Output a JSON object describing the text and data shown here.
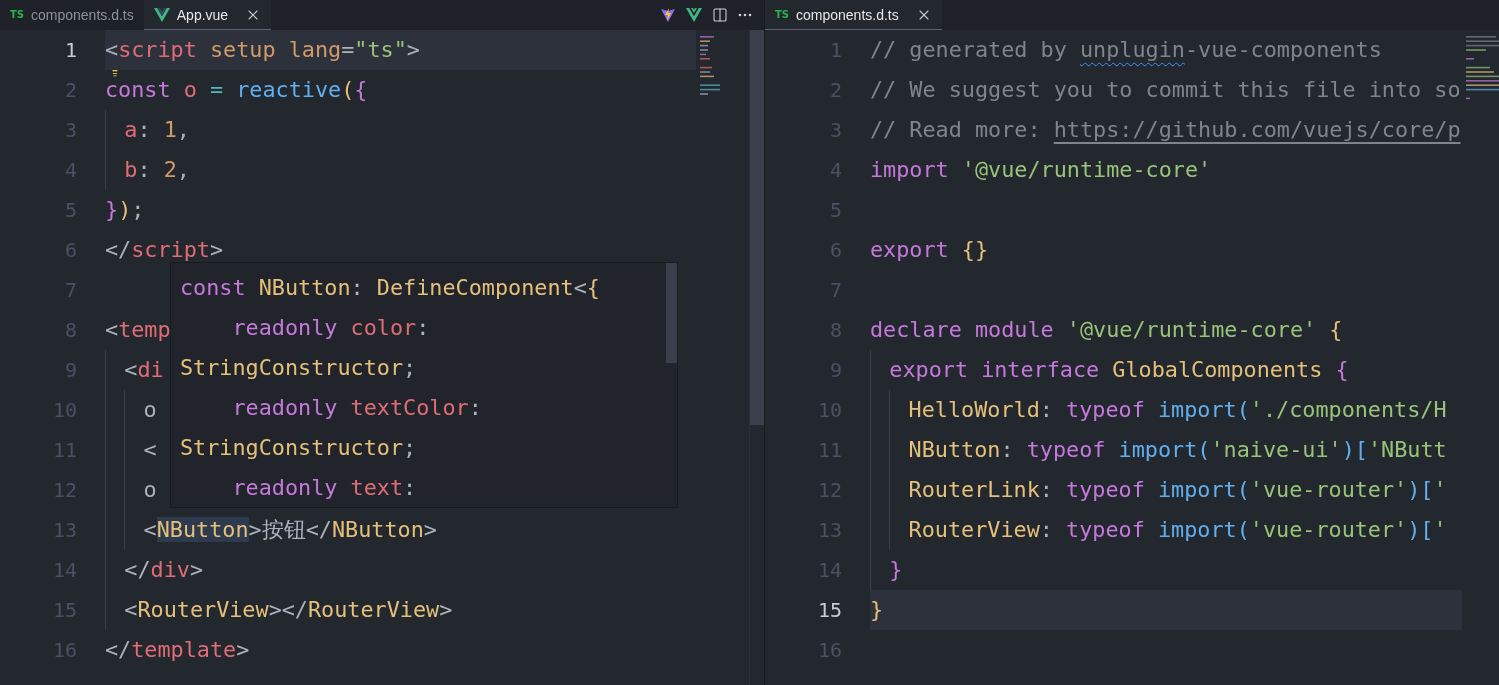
{
  "left_group": {
    "tabs": [
      {
        "label": "components.d.ts",
        "kind": "ts",
        "badge": "TS",
        "selected": false
      },
      {
        "label": "App.vue",
        "kind": "vue",
        "selected": true
      }
    ],
    "editor": {
      "lines": [
        {
          "number": "1",
          "current": true,
          "lightbulb": false,
          "tokens": [
            {
              "kind": "punct",
              "t": "<"
            },
            {
              "kind": "tag",
              "t": "script"
            },
            {
              "kind": "attr",
              "t": " setup lang"
            },
            {
              "kind": "punct",
              "t": "="
            },
            {
              "kind": "string",
              "t": "\"ts\""
            },
            {
              "kind": "punct",
              "t": ">"
            }
          ]
        },
        {
          "number": "2",
          "current": false,
          "lightbulb": true,
          "tokens": [
            {
              "kind": "keyword",
              "t": "const"
            },
            {
              "kind": "var",
              "t": " o"
            },
            {
              "kind": "op",
              "t": " = "
            },
            {
              "kind": "func",
              "t": "reactive"
            },
            {
              "kind": "bracket",
              "t": "("
            },
            {
              "kind": "bracket2",
              "t": "{"
            }
          ]
        },
        {
          "number": "3",
          "current": false,
          "lightbulb": false,
          "tokens": [
            {
              "kind": "var",
              "t": "  a"
            },
            {
              "kind": "punct",
              "t": ": "
            },
            {
              "kind": "number",
              "t": "1"
            },
            {
              "kind": "punct",
              "t": ","
            }
          ]
        },
        {
          "number": "4",
          "current": false,
          "lightbulb": false,
          "tokens": [
            {
              "kind": "var",
              "t": "  b"
            },
            {
              "kind": "punct",
              "t": ": "
            },
            {
              "kind": "number",
              "t": "2"
            },
            {
              "kind": "punct",
              "t": ","
            }
          ]
        },
        {
          "number": "5",
          "current": false,
          "lightbulb": false,
          "tokens": [
            {
              "kind": "bracket2",
              "t": "}"
            },
            {
              "kind": "bracket",
              "t": ")"
            },
            {
              "kind": "punct",
              "t": ";"
            }
          ]
        },
        {
          "number": "6",
          "current": false,
          "lightbulb": false,
          "tokens": [
            {
              "kind": "punct",
              "t": "</"
            },
            {
              "kind": "tag",
              "t": "script"
            },
            {
              "kind": "punct",
              "t": ">"
            }
          ]
        },
        {
          "number": "7",
          "current": false,
          "lightbulb": false
        },
        {
          "number": "8",
          "current": false,
          "lightbulb": false,
          "tokens": [
            {
              "kind": "punct",
              "t": "<"
            },
            {
              "kind": "tag",
              "t": "temp"
            }
          ]
        },
        {
          "number": "9",
          "current": false,
          "lightbulb": false,
          "tokens": [
            {
              "kind": "punct",
              "t": "  <"
            },
            {
              "kind": "tag",
              "t": "di"
            }
          ]
        },
        {
          "number": "10",
          "current": false,
          "lightbulb": false,
          "tokens": [
            {
              "kind": "plain",
              "t": "    o"
            }
          ]
        },
        {
          "number": "11",
          "current": false,
          "lightbulb": false,
          "tokens": [
            {
              "kind": "punct",
              "t": "    <"
            }
          ]
        },
        {
          "number": "12",
          "current": false,
          "lightbulb": false,
          "tokens": [
            {
              "kind": "plain",
              "t": "    o"
            }
          ]
        },
        {
          "number": "13",
          "current": false,
          "lightbulb": false,
          "tokens": [
            {
              "kind": "punct",
              "t": "    <"
            },
            {
              "kind": "type",
              "t": "NButton",
              "highlight": true
            },
            {
              "kind": "punct",
              "t": ">"
            },
            {
              "kind": "plain",
              "t": "按钮"
            },
            {
              "kind": "punct",
              "t": "</"
            },
            {
              "kind": "type",
              "t": "NButton"
            },
            {
              "kind": "punct",
              "t": ">"
            }
          ]
        },
        {
          "number": "14",
          "current": false,
          "lightbulb": false,
          "tokens": [
            {
              "kind": "punct",
              "t": "  </"
            },
            {
              "kind": "tag",
              "t": "div"
            },
            {
              "kind": "punct",
              "t": ">"
            }
          ]
        },
        {
          "number": "15",
          "current": false,
          "lightbulb": false,
          "tokens": [
            {
              "kind": "punct",
              "t": "  <"
            },
            {
              "kind": "type",
              "t": "RouterView"
            },
            {
              "kind": "punct",
              "t": "></"
            },
            {
              "kind": "type",
              "t": "RouterView"
            },
            {
              "kind": "punct",
              "t": ">"
            }
          ]
        },
        {
          "number": "16",
          "current": false,
          "lightbulb": false,
          "tokens": [
            {
              "kind": "punct",
              "t": "</"
            },
            {
              "kind": "tag",
              "t": "template"
            },
            {
              "kind": "punct",
              "t": ">"
            }
          ]
        }
      ],
      "hover": {
        "lines": [
          {
            "tokens": [
              {
                "kind": "keyword",
                "t": "const"
              },
              {
                "kind": "type",
                "t": " NButton"
              },
              {
                "kind": "punct",
                "t": ": "
              },
              {
                "kind": "type",
                "t": "DefineComponent"
              },
              {
                "kind": "punct",
                "t": "<"
              },
              {
                "kind": "bracket",
                "t": "{"
              }
            ]
          },
          {
            "tokens": [
              {
                "kind": "keyword",
                "t": "    readonly"
              },
              {
                "kind": "var",
                "t": " color"
              },
              {
                "kind": "punct",
                "t": ":"
              }
            ]
          },
          {
            "tokens": [
              {
                "kind": "type",
                "t": "StringConstructor"
              },
              {
                "kind": "punct",
                "t": ";"
              }
            ]
          },
          {
            "tokens": [
              {
                "kind": "keyword",
                "t": "    readonly"
              },
              {
                "kind": "var",
                "t": " textColor"
              },
              {
                "kind": "punct",
                "t": ":"
              }
            ]
          },
          {
            "tokens": [
              {
                "kind": "type",
                "t": "StringConstructor"
              },
              {
                "kind": "punct",
                "t": ";"
              }
            ]
          },
          {
            "tokens": [
              {
                "kind": "keyword",
                "t": "    readonly"
              },
              {
                "kind": "var",
                "t": " text"
              },
              {
                "kind": "punct",
                "t": ":"
              }
            ]
          }
        ]
      }
    }
  },
  "right_group": {
    "tabs": [
      {
        "label": "components.d.ts",
        "kind": "ts",
        "badge": "TS",
        "selected": true
      }
    ],
    "editor": {
      "lines": [
        {
          "number": "1",
          "current": false,
          "tokens": [
            {
              "kind": "comment",
              "t": "// generated by "
            },
            {
              "kind": "comment",
              "t": "unplugin",
              "squiggle": true
            },
            {
              "kind": "comment",
              "t": "-vue-components"
            }
          ]
        },
        {
          "number": "2",
          "current": false,
          "tokens": [
            {
              "kind": "comment",
              "t": "// We suggest you to commit this file into so"
            }
          ]
        },
        {
          "number": "3",
          "current": false,
          "tokens": [
            {
              "kind": "comment",
              "t": "// Read more: "
            },
            {
              "kind": "link",
              "t": "https://github.com/vuejs/core/p"
            }
          ]
        },
        {
          "number": "4",
          "current": false,
          "tokens": [
            {
              "kind": "keyword",
              "t": "import"
            },
            {
              "kind": "string",
              "t": " '@vue/runtime-core'"
            }
          ]
        },
        {
          "number": "5",
          "current": false
        },
        {
          "number": "6",
          "current": false,
          "tokens": [
            {
              "kind": "keyword",
              "t": "export"
            },
            {
              "kind": "bracket",
              "t": " {}"
            }
          ]
        },
        {
          "number": "7",
          "current": false
        },
        {
          "number": "8",
          "current": false,
          "tokens": [
            {
              "kind": "keyword",
              "t": "declare module"
            },
            {
              "kind": "string",
              "t": " '@vue/runtime-core'"
            },
            {
              "kind": "bracket",
              "t": " {"
            }
          ]
        },
        {
          "number": "9",
          "current": false,
          "tokens": [
            {
              "kind": "keyword",
              "t": "  export interface"
            },
            {
              "kind": "type",
              "t": " GlobalComponents"
            },
            {
              "kind": "bracket2",
              "t": " {"
            }
          ]
        },
        {
          "number": "10",
          "current": false,
          "tokens": [
            {
              "kind": "type",
              "t": "    HelloWorld"
            },
            {
              "kind": "punct",
              "t": ": "
            },
            {
              "kind": "keyword",
              "t": "typeof"
            },
            {
              "kind": "func",
              "t": " import"
            },
            {
              "kind": "bracket3",
              "t": "("
            },
            {
              "kind": "string",
              "t": "'./components/H"
            }
          ]
        },
        {
          "number": "11",
          "current": false,
          "tokens": [
            {
              "kind": "type",
              "t": "    NButton"
            },
            {
              "kind": "punct",
              "t": ": "
            },
            {
              "kind": "keyword",
              "t": "typeof"
            },
            {
              "kind": "func",
              "t": " import"
            },
            {
              "kind": "bracket3",
              "t": "("
            },
            {
              "kind": "string",
              "t": "'naive-ui'"
            },
            {
              "kind": "bracket3",
              "t": ")["
            },
            {
              "kind": "string",
              "t": "'NButt"
            }
          ]
        },
        {
          "number": "12",
          "current": false,
          "tokens": [
            {
              "kind": "type",
              "t": "    RouterLink"
            },
            {
              "kind": "punct",
              "t": ": "
            },
            {
              "kind": "keyword",
              "t": "typeof"
            },
            {
              "kind": "func",
              "t": " import"
            },
            {
              "kind": "bracket3",
              "t": "("
            },
            {
              "kind": "string",
              "t": "'vue-router'"
            },
            {
              "kind": "bracket3",
              "t": ")["
            },
            {
              "kind": "string",
              "t": "'"
            }
          ]
        },
        {
          "number": "13",
          "current": false,
          "tokens": [
            {
              "kind": "type",
              "t": "    RouterView"
            },
            {
              "kind": "punct",
              "t": ": "
            },
            {
              "kind": "keyword",
              "t": "typeof"
            },
            {
              "kind": "func",
              "t": " import"
            },
            {
              "kind": "bracket3",
              "t": "("
            },
            {
              "kind": "string",
              "t": "'vue-router'"
            },
            {
              "kind": "bracket3",
              "t": ")["
            },
            {
              "kind": "string",
              "t": "'"
            }
          ]
        },
        {
          "number": "14",
          "current": false,
          "tokens": [
            {
              "kind": "bracket2",
              "t": "  }"
            }
          ]
        },
        {
          "number": "15",
          "current": true,
          "tokens": [
            {
              "kind": "bracket",
              "t": "}"
            }
          ]
        },
        {
          "number": "16",
          "current": false
        }
      ]
    }
  }
}
